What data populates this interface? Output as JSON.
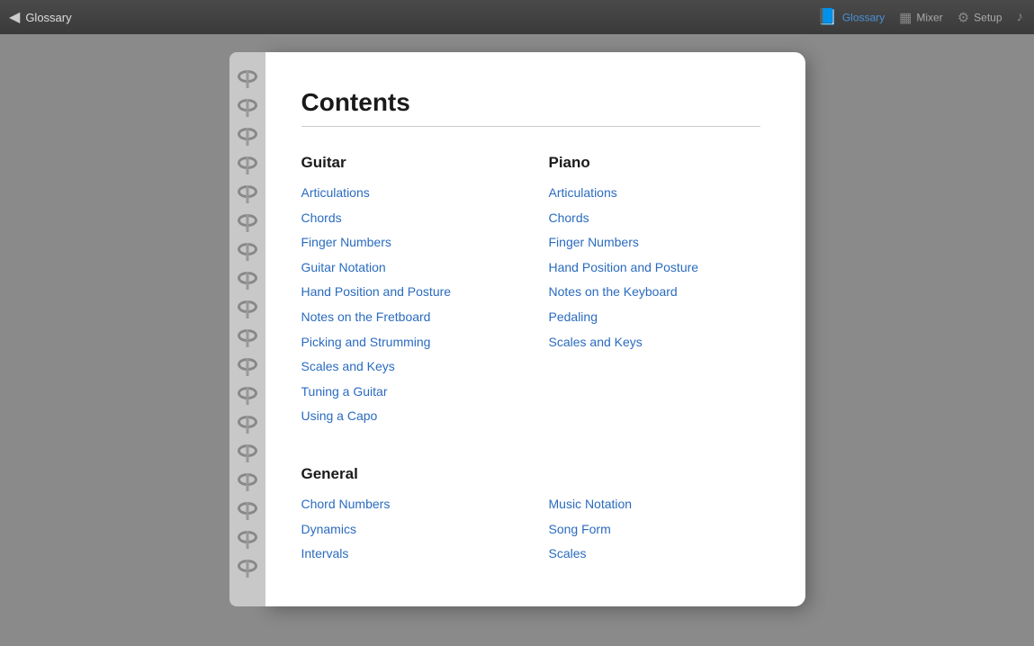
{
  "topbar": {
    "back_label": "Glossary",
    "nav_items": [
      {
        "id": "glossary",
        "label": "Glossary",
        "icon": "📘",
        "active": true
      },
      {
        "id": "mixer",
        "label": "Mixer",
        "icon": "⊞",
        "active": false
      },
      {
        "id": "setup",
        "label": "Setup",
        "icon": "⚙",
        "active": false
      },
      {
        "id": "music",
        "label": "",
        "icon": "♪",
        "active": false
      }
    ]
  },
  "page": {
    "title": "Contents",
    "guitar": {
      "heading": "Guitar",
      "links": [
        "Articulations",
        "Chords",
        "Finger Numbers",
        "Guitar Notation",
        "Hand Position and Posture",
        "Notes on the Fretboard",
        "Picking and Strumming",
        "Scales and Keys",
        "Tuning a Guitar",
        "Using a Capo"
      ]
    },
    "piano": {
      "heading": "Piano",
      "links": [
        "Articulations",
        "Chords",
        "Finger Numbers",
        "Hand Position and Posture",
        "Notes on the Keyboard",
        "Pedaling",
        "Scales and Keys"
      ]
    },
    "general": {
      "heading": "General",
      "left_links": [
        "Chord Numbers",
        "Dynamics",
        "Intervals"
      ],
      "right_links": [
        "Music Notation",
        "Song Form",
        "Scales"
      ]
    }
  },
  "spiral_count": 18
}
